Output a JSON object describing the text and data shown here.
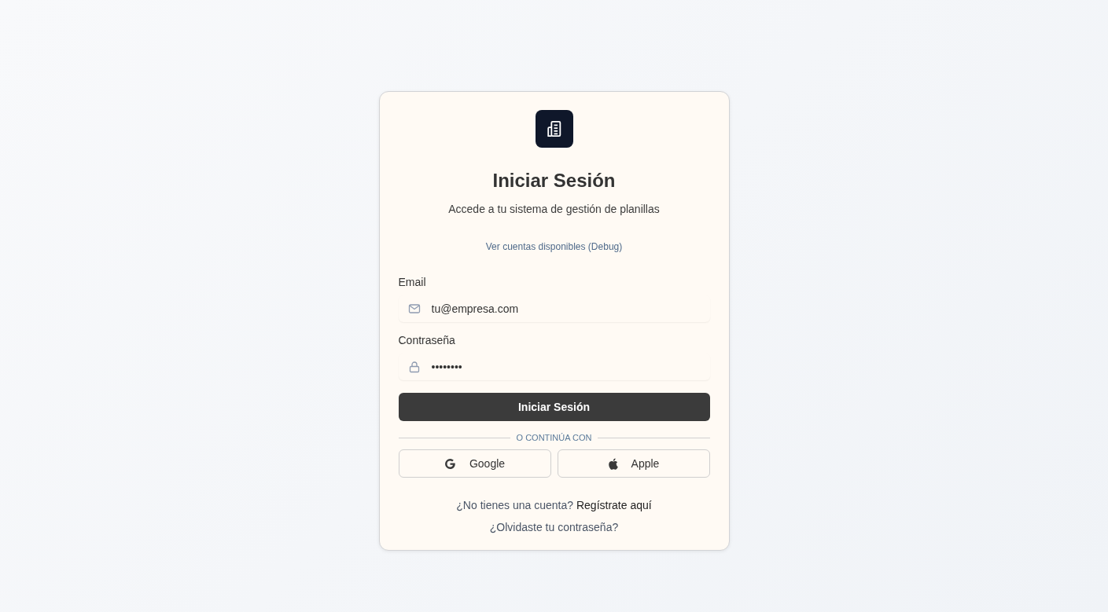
{
  "card": {
    "title": "Iniciar Sesión",
    "subtitle": "Accede a tu sistema de gestión de planillas",
    "debug_link": "Ver cuentas disponibles (Debug)"
  },
  "fields": [
    {
      "label": "Email",
      "kind": "email",
      "value": "tu@empresa.com"
    },
    {
      "label": "Contraseña",
      "kind": "password",
      "value": "••••••••"
    }
  ],
  "submit_button": "Iniciar Sesión",
  "divider": "O CONTINÚA CON",
  "social_buttons": [
    {
      "label": "Google",
      "kind": "google"
    },
    {
      "label": "Apple",
      "kind": "apple"
    }
  ],
  "signup": {
    "prompt": "¿No tienes una cuenta?",
    "link": "Regístrate aquí"
  },
  "forgot_link": "¿Olvidaste tu contraseña?"
}
